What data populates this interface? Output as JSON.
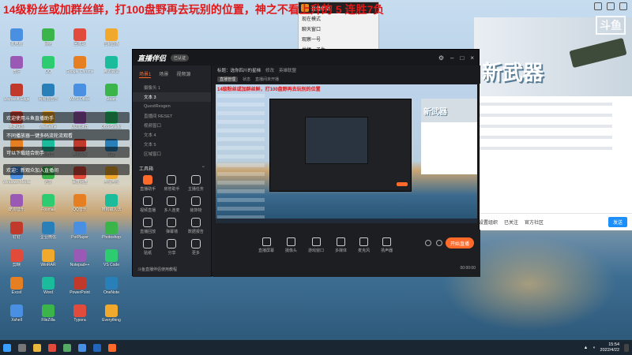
{
  "overlay": {
    "stream_title": "14级粉丝或加群丝鲜，打100盘野再去玩别的位置，神之不看上升的 5 连胜7负"
  },
  "popup": {
    "header": "直播伴侣",
    "rows": [
      "现在模式",
      "聊天窗口",
      "观察一号",
      "井绳一子生"
    ]
  },
  "desktop": {
    "icons": [
      "此电脑",
      "网络",
      "回收站",
      "控制面板",
      "微信",
      "QQ",
      "Google Chrome",
      "腾讯会议",
      "Microsoft Edge",
      "网易云音乐",
      "WPS Office",
      "Steam",
      "英雄联盟",
      "WeGame",
      "UU加速器",
      "OBS Studio",
      "直播伴侣",
      "爱奇艺",
      "腾讯视频",
      "优酷",
      "Windows Media",
      "迅雷",
      "百度网盘",
      "哔哩哔哩",
      "酷狗音乐",
      "Foxmail",
      "QQ音乐",
      "搜狗输入法",
      "钉钉",
      "企业微信",
      "PotPlayer",
      "Photoshop",
      "剪映",
      "WinRAR",
      "Notepad++",
      "VS Code",
      "Excel",
      "Word",
      "PowerPoint",
      "OneNote",
      "Xshell",
      "FileZilla",
      "Typora",
      "Everything"
    ],
    "chat_lines": [
      "欢迎使用斗鱼直播助手",
      "不同播放器一键多码流轮流观看",
      "可以下载组合助手",
      "欢迎：新观众加入直播间"
    ]
  },
  "app": {
    "logo": "直播伴侣",
    "badge": "已认证",
    "left_tabs": [
      "场景1",
      "场景",
      "视频源"
    ],
    "scenes": [
      "摄像头 1",
      "文本 3",
      "QuestResgen",
      "直播间 RESET",
      "视频窗口",
      "文本 4",
      "文本 5",
      "区域窗口"
    ],
    "tools_title": "工具箱",
    "tools": [
      "直播助手",
      "房管助手",
      "主播任务",
      "视频直播",
      "多人连麦",
      "装饰物",
      "直播回放",
      "弹幕墙",
      "数据报告",
      "贴纸",
      "分享",
      "更多"
    ],
    "tip": "斗鱼直播伴侣使用教程",
    "title": "标题：选你四川的星梯",
    "title_btn": "修改",
    "category": "英雄联盟",
    "subbar": [
      "直播管理",
      "状态",
      "直播间未开播"
    ],
    "bottom_tools": [
      "直播屏幕",
      "摄像头",
      "游戏窗口",
      "多媒体",
      "麦克风",
      "扬声器"
    ],
    "go_live": "开始直播",
    "time": "00:00:00"
  },
  "preview": {
    "overlay": "14级粉丝或加群丝鲜，打100盘野再去玩别的位置",
    "banner": "新武器"
  },
  "right": {
    "banner": "新武器",
    "brand": "斗鱼",
    "bottom_links": [
      "设置组织",
      "已关注",
      "官方社区"
    ],
    "send": "发送"
  },
  "taskbar": {
    "time": "15:54",
    "date": "2022/4/22"
  },
  "colors": {
    "accent": "#ff6a2a",
    "overlay_red": "#e01818",
    "app_bg": "#1d1e22"
  }
}
